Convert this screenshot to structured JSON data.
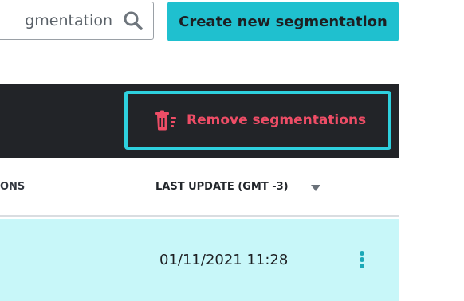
{
  "search": {
    "value": "gmentation"
  },
  "actions": {
    "create_label": "Create new segmentation"
  },
  "toolbar": {
    "remove_label": "Remove segmentations"
  },
  "table": {
    "columns": [
      "ONS",
      "LAST UPDATE (GMT -3)"
    ],
    "rows": [
      {
        "last_update": "01/11/2021 11:28"
      }
    ]
  },
  "colors": {
    "accent": "#1fc0cf",
    "danger": "#ee4d66",
    "toolbar_bg": "#222428",
    "selected_row": "#c8f7f9",
    "focus_ring": "#2ed0de"
  },
  "icons": [
    "search-icon",
    "trash-icon",
    "sort-down-icon",
    "kebab-menu-icon"
  ]
}
